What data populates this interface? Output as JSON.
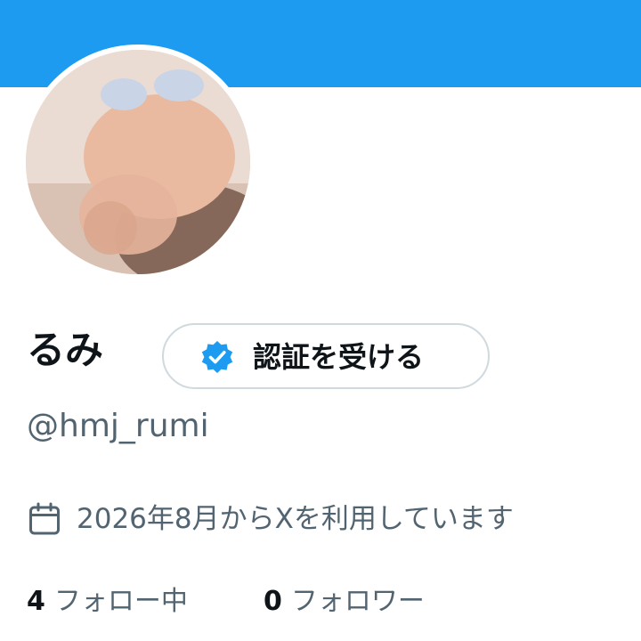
{
  "profile": {
    "display_name": "るみ",
    "handle": "@hmj_rumi",
    "joined": "2026年8月からXを利用しています",
    "verify_button_label": "認証を受ける"
  },
  "stats": {
    "following_count": "4",
    "following_label": "フォロー中",
    "followers_count": "0",
    "followers_label": "フォロワー"
  },
  "icons": {
    "verify": "verified-badge-icon",
    "calendar": "calendar-icon"
  },
  "colors": {
    "banner": "#1d9bf0",
    "badge": "#1d9bf0",
    "secondary_text": "#536471",
    "primary_text": "#0f1419",
    "button_border": "#cfd9de"
  }
}
